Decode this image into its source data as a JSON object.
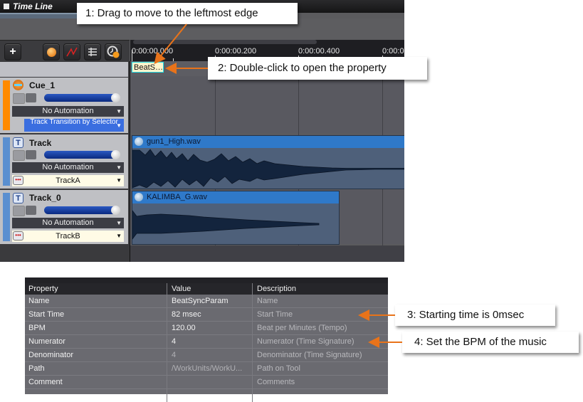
{
  "window": {
    "title": "Time Line"
  },
  "toolbar": {
    "buttons": [
      {
        "name": "add",
        "icon": "plus-icon"
      },
      {
        "name": "record",
        "icon": "orange-ball-icon"
      },
      {
        "name": "automation-curve",
        "icon": "curve-icon"
      },
      {
        "name": "list",
        "icon": "list-icon"
      },
      {
        "name": "clock",
        "icon": "clock-icon"
      }
    ]
  },
  "ruler": {
    "ticks": [
      "0:00:00.000",
      "0:00:00.200",
      "0:00:00.400",
      "0:00:0"
    ]
  },
  "cue_marker": {
    "label": "BeatS…"
  },
  "tracks": [
    {
      "name": "Cue_1",
      "color": "#ff8a00",
      "automation": "No Automation",
      "selector": "Track Transition by Selector"
    },
    {
      "name": "Track",
      "color": "#5a8fd0",
      "automation": "No Automation",
      "selector": "TrackA",
      "clip": "gun1_High.wav"
    },
    {
      "name": "Track_0",
      "color": "#5a8fd0",
      "automation": "No Automation",
      "selector": "TrackB",
      "clip": "KALIMBA_G.wav"
    }
  ],
  "callouts": [
    "1:  Drag to move to the leftmost edge",
    "2:  Double-click to open the property",
    "3:  Starting time is 0msec",
    "4:  Set the BPM of the music"
  ],
  "property_table": {
    "headers": [
      "Property",
      "Value",
      "Description"
    ],
    "rows": [
      [
        "Name",
        "BeatSyncParam",
        "Name"
      ],
      [
        "Start Time",
        "82 msec",
        "Start Time"
      ],
      [
        "BPM",
        "120.00",
        "Beat per Minutes (Tempo)"
      ],
      [
        "Numerator",
        "4",
        "Numerator (Time Signature)"
      ],
      [
        "Denominator",
        "4",
        "Denominator (Time Signature)"
      ],
      [
        "Path",
        "/WorkUnits/WorkU...",
        "Path on Tool"
      ],
      [
        "Comment",
        "",
        "Comments"
      ]
    ]
  },
  "colors": {
    "accent_orange": "#e8731a",
    "clip_header": "#2f79c9",
    "waveform": "#13243d"
  }
}
